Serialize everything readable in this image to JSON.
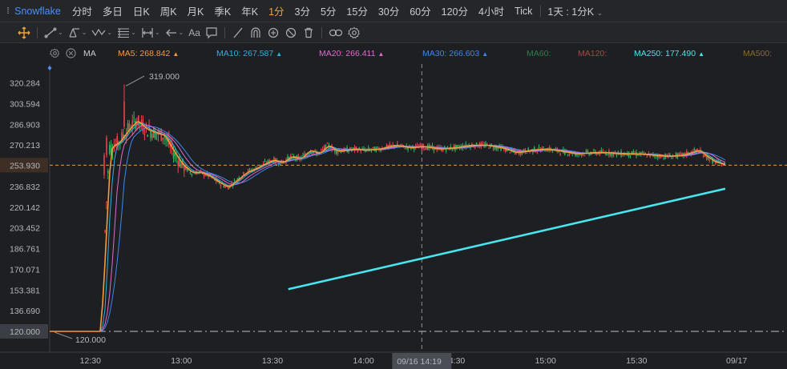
{
  "period_bar": {
    "items": [
      {
        "label": "Snowflake",
        "kind": "brand"
      },
      {
        "label": "分时"
      },
      {
        "label": "多日"
      },
      {
        "label": "日K"
      },
      {
        "label": "周K"
      },
      {
        "label": "月K"
      },
      {
        "label": "季K"
      },
      {
        "label": "年K"
      },
      {
        "label": "1分",
        "active": true
      },
      {
        "label": "3分"
      },
      {
        "label": "5分"
      },
      {
        "label": "15分"
      },
      {
        "label": "30分"
      },
      {
        "label": "60分"
      },
      {
        "label": "120分"
      },
      {
        "label": "4小时"
      },
      {
        "label": "Tick"
      }
    ],
    "combo_label": "1天 : 1分K"
  },
  "toolbar": {
    "icons": [
      "crosshair-move-icon",
      "trend-line-icon",
      "pitchfork-icon",
      "wave-icon",
      "fibonacci-icon",
      "measure-icon",
      "arrow-icon",
      "text-icon",
      "note-icon",
      "ruler-icon",
      "magnet-icon",
      "sync-icon",
      "hide-icon",
      "trash-icon",
      "link-icon",
      "settings-icon"
    ],
    "text_tool_label": "Aa"
  },
  "ma_legend": {
    "label": "MA",
    "items": [
      {
        "name": "MA5",
        "value": "268.842",
        "color": "#f39c3c",
        "arrow": "▲"
      },
      {
        "name": "MA10",
        "value": "267.587",
        "color": "#2ab2e0",
        "arrow": "▲"
      },
      {
        "name": "MA20",
        "value": "266.411",
        "color": "#e06ad0",
        "arrow": "▲"
      },
      {
        "name": "MA30",
        "value": "266.603",
        "color": "#3d86f0",
        "arrow": "▲"
      },
      {
        "name": "MA60",
        "value": "",
        "color": "#2e7d4a",
        "arrow": ""
      },
      {
        "name": "MA120",
        "value": "",
        "color": "#a34b3f",
        "arrow": ""
      },
      {
        "name": "MA250",
        "value": "177.490",
        "color": "#47e6f0",
        "arrow": "▲"
      },
      {
        "name": "MA500",
        "value": "",
        "color": "#8a6b2f",
        "arrow": ""
      }
    ]
  },
  "chart_data": {
    "type": "candlestick",
    "ticker": "Snowflake",
    "interval": "1分",
    "y_ticks": [
      "320.284",
      "303.594",
      "286.903",
      "270.213",
      "253.930",
      "236.832",
      "220.142",
      "203.452",
      "186.761",
      "170.071",
      "153.381",
      "136.690",
      "120.000"
    ],
    "ylim": [
      120.0,
      320.284
    ],
    "current_price": "253.930",
    "reference_price": "120.000",
    "high_annotation": "319.000",
    "low_annotation": "120.000",
    "x_ticks": [
      "12:30",
      "13:00",
      "13:30",
      "14:00",
      "14:30",
      "15:00",
      "15:30",
      "09/17"
    ],
    "crosshair_label": "09/16 14:19",
    "price_path": [
      [
        "12:30",
        120.0
      ],
      [
        "12:33",
        125.0
      ],
      [
        "12:36",
        268.0
      ],
      [
        "12:39",
        272.0
      ],
      [
        "12:42",
        282.0
      ],
      [
        "12:45",
        290.0
      ],
      [
        "12:48",
        283.0
      ],
      [
        "12:51",
        280.0
      ],
      [
        "12:54",
        278.0
      ],
      [
        "12:57",
        265.0
      ],
      [
        "13:00",
        254.0
      ],
      [
        "13:03",
        248.0
      ],
      [
        "13:06",
        248.0
      ],
      [
        "13:09",
        245.0
      ],
      [
        "13:12",
        240.0
      ],
      [
        "13:15",
        236.0
      ],
      [
        "13:18",
        242.0
      ],
      [
        "13:21",
        248.0
      ],
      [
        "13:24",
        251.0
      ],
      [
        "13:27",
        255.0
      ],
      [
        "13:30",
        258.0
      ],
      [
        "13:33",
        256.0
      ],
      [
        "13:36",
        261.0
      ],
      [
        "13:39",
        259.0
      ],
      [
        "13:42",
        266.0
      ],
      [
        "13:45",
        263.0
      ],
      [
        "13:48",
        270.0
      ],
      [
        "13:51",
        265.0
      ],
      [
        "13:54",
        266.0
      ],
      [
        "13:57",
        267.0
      ],
      [
        "14:00",
        266.0
      ],
      [
        "14:05",
        267.0
      ],
      [
        "14:10",
        270.0
      ],
      [
        "14:15",
        268.0
      ],
      [
        "14:19",
        269.0
      ],
      [
        "14:25",
        267.0
      ],
      [
        "14:30",
        268.0
      ],
      [
        "14:35",
        270.0
      ],
      [
        "14:40",
        270.0
      ],
      [
        "14:45",
        268.0
      ],
      [
        "14:50",
        264.0
      ],
      [
        "14:55",
        266.0
      ],
      [
        "15:00",
        267.0
      ],
      [
        "15:05",
        265.0
      ],
      [
        "15:10",
        263.0
      ],
      [
        "15:15",
        264.0
      ],
      [
        "15:20",
        264.0
      ],
      [
        "15:25",
        263.0
      ],
      [
        "15:30",
        263.0
      ],
      [
        "15:35",
        262.0
      ],
      [
        "15:40",
        261.0
      ],
      [
        "15:45",
        262.0
      ],
      [
        "15:50",
        266.0
      ],
      [
        "15:55",
        257.0
      ],
      [
        "15:59",
        254.0
      ]
    ],
    "ma250_path": [
      [
        "13:35",
        154.0
      ],
      [
        "15:59",
        235.0
      ]
    ]
  }
}
